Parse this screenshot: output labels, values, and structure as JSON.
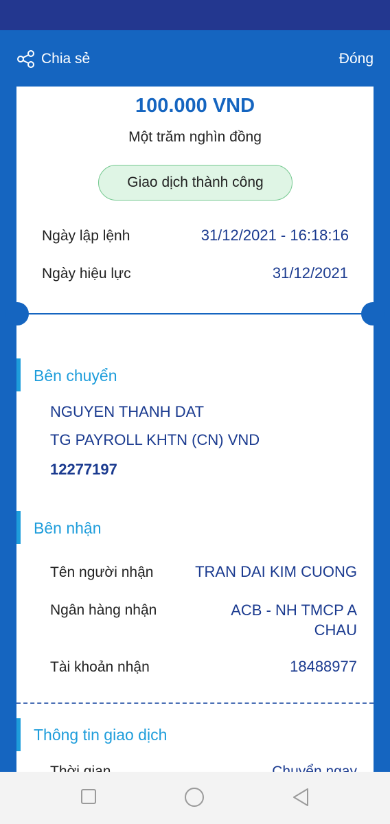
{
  "header": {
    "share_label": "Chia sẻ",
    "close_label": "Đóng"
  },
  "receipt": {
    "amount": "100.000 VND",
    "amount_in_words": "Một trăm nghìn đồng",
    "status": "Giao dịch thành công",
    "order_date_label": "Ngày lập lệnh",
    "order_date_value": "31/12/2021 - 16:18:16",
    "effective_date_label": "Ngày hiệu lực",
    "effective_date_value": "31/12/2021"
  },
  "sender": {
    "title": "Bên chuyển",
    "name": "NGUYEN THANH DAT",
    "account_name": "TG PAYROLL KHTN (CN) VND",
    "account_number": "12277197"
  },
  "receiver": {
    "title": "Bên nhận",
    "name_label": "Tên người nhận",
    "name_value": "TRAN DAI KIM CUONG",
    "bank_label": "Ngân hàng nhận",
    "bank_value_line1": "ACB - NH TMCP A",
    "bank_value_line2": "CHAU",
    "account_label": "Tài khoản nhận",
    "account_value": "18488977"
  },
  "transaction": {
    "title": "Thông tin giao dịch",
    "time_label_partial": "Thời gian",
    "time_value_partial": "Chuyển ngay"
  },
  "colors": {
    "brand_blue": "#1565c0",
    "status_bar": "#23378f",
    "section_accent": "#1e9ddb",
    "value_text": "#1a3a8f",
    "success_bg": "#dff5e5",
    "success_border": "#74c88f"
  },
  "navbar": {
    "icons": [
      "recent-apps-icon",
      "home-icon",
      "back-icon"
    ]
  }
}
